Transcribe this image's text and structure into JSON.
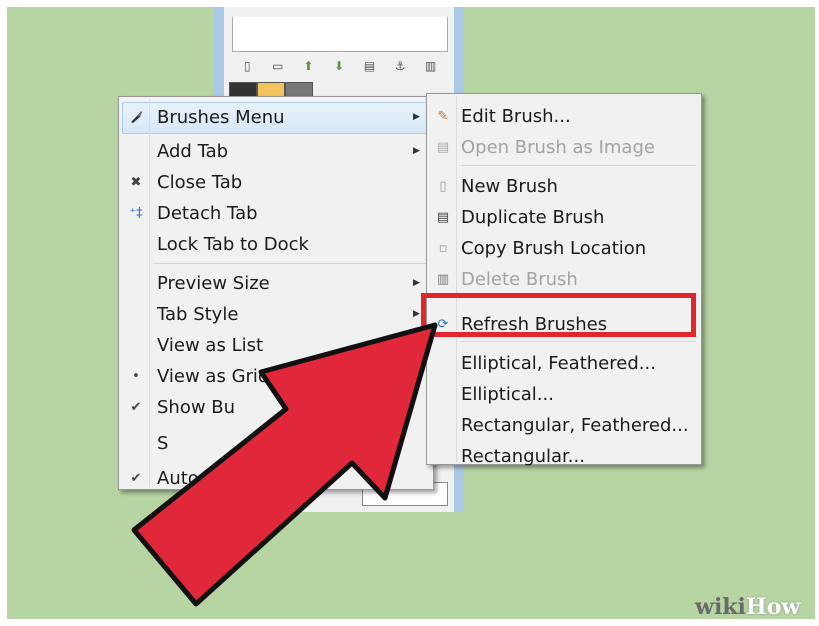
{
  "main_menu": {
    "items": [
      {
        "label": "Brushes Menu",
        "icon": "paintbrush-icon",
        "submenu": true
      },
      {
        "label": "Add Tab",
        "icon": "",
        "submenu": true
      },
      {
        "label": "Close Tab",
        "icon": "close-x-icon",
        "submenu": false
      },
      {
        "label": "Detach Tab",
        "icon": "detach-icon",
        "submenu": false
      },
      {
        "label": "Lock Tab to Dock",
        "icon": "",
        "submenu": false
      },
      {
        "label": "Preview Size",
        "icon": "",
        "submenu": true
      },
      {
        "label": "Tab Style",
        "icon": "",
        "submenu": true
      },
      {
        "label": "View as List",
        "icon": "",
        "submenu": false
      },
      {
        "label": "View as Grid",
        "icon": "radio-bullet-icon",
        "submenu": false
      },
      {
        "label": "Show Bu",
        "icon": "checkmark-icon",
        "submenu": false
      },
      {
        "label": "S",
        "icon": "",
        "submenu": false
      },
      {
        "label": "Auto Fo",
        "icon": "checkmark-icon",
        "submenu": false
      }
    ]
  },
  "sub_menu": {
    "items": [
      {
        "label": "Edit Brush...",
        "icon": "edit-brush-icon",
        "disabled": false
      },
      {
        "label": "Open Brush as Image",
        "icon": "open-image-icon",
        "disabled": true
      },
      {
        "label": "New Brush",
        "icon": "new-document-icon",
        "disabled": false
      },
      {
        "label": "Duplicate Brush",
        "icon": "duplicate-icon",
        "disabled": false
      },
      {
        "label": "Copy Brush Location",
        "icon": "copy-location-icon",
        "disabled": false
      },
      {
        "label": "Delete Brush",
        "icon": "trash-icon",
        "disabled": true
      },
      {
        "label": "Refresh Brushes",
        "icon": "refresh-icon",
        "disabled": false
      },
      {
        "label": "Elliptical, Feathered...",
        "icon": "",
        "disabled": false
      },
      {
        "label": "Elliptical...",
        "icon": "",
        "disabled": false
      },
      {
        "label": "Rectangular, Feathered...",
        "icon": "",
        "disabled": false
      },
      {
        "label": "Rectangular...",
        "icon": "",
        "disabled": false
      }
    ]
  },
  "dock_toolbar": [
    "new-document-icon",
    "folder-icon",
    "up-arrow-icon",
    "down-arrow-icon",
    "duplicate-icon",
    "anchor-icon",
    "trash-icon"
  ],
  "watermark": {
    "wiki": "wiki",
    "how": "How"
  },
  "colors": {
    "highlight": "#e1262c",
    "arrow": "#e0283a",
    "background": "#b7d4a3"
  }
}
